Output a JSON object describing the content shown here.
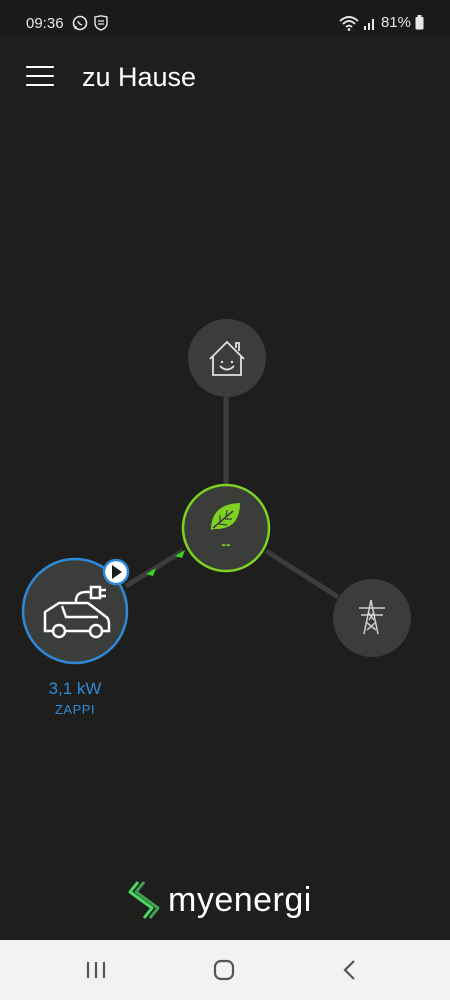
{
  "status_bar": {
    "time": "09:36",
    "battery": "81%",
    "icons": [
      "whatsapp-icon",
      "shield-icon",
      "wifi-icon",
      "signal-icon",
      "battery-icon"
    ]
  },
  "app_bar": {
    "title": "zu Hause",
    "menu_icon": "hamburger-menu-icon"
  },
  "energy_flow": {
    "hub": {
      "icon": "leaf-icon",
      "value": "--",
      "color": "#7ed321"
    },
    "home": {
      "icon": "house-icon"
    },
    "grid": {
      "icon": "power-tower-icon"
    },
    "charger": {
      "icon": "car-plug-icon",
      "power": "3,1 kW",
      "name": "ZAPPI",
      "color": "#2e8ad8",
      "status_icon": "play-icon"
    }
  },
  "brand": {
    "name": "myenergi",
    "accent": "#4cd964"
  },
  "nav_bar": {
    "items": [
      "recent-apps-icon",
      "home-icon",
      "back-icon"
    ]
  }
}
